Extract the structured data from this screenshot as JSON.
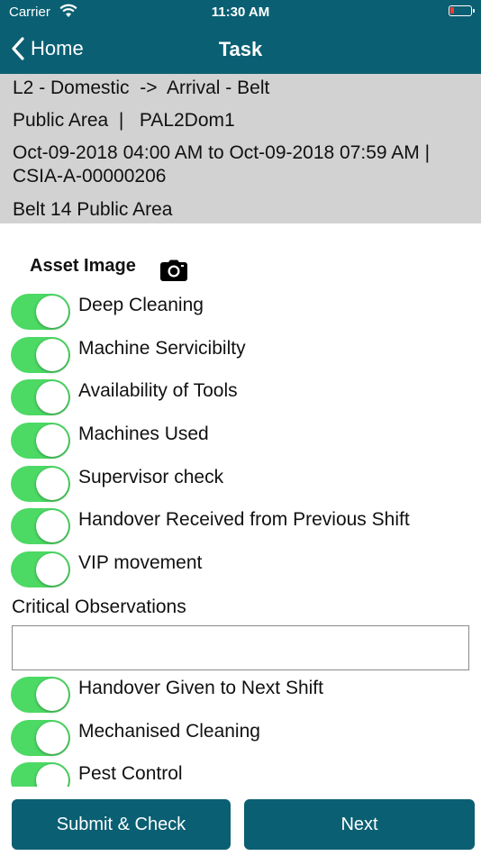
{
  "status_bar": {
    "carrier": "Carrier",
    "time": "11:30 AM",
    "battery_color": "#ff3b30"
  },
  "nav": {
    "back_label": "Home",
    "title": "Task"
  },
  "info": {
    "route": "L2 - Domestic  ->  Arrival - Belt",
    "area": "Public Area  |   PAL2Dom1",
    "schedule_line1": "Oct-09-2018 04:00 AM to Oct-09-2018 07:59 AM |",
    "schedule_line2": "CSIA-A-00000206",
    "location": "Belt 14 Public Area"
  },
  "asset": {
    "label": "Asset Image",
    "icon": "camera-icon"
  },
  "checklist": [
    {
      "label": "Deep Cleaning",
      "on": true
    },
    {
      "label": "Machine Servicibilty",
      "on": true
    },
    {
      "label": "Availability of Tools",
      "on": true
    },
    {
      "label": "Machines Used",
      "on": true
    },
    {
      "label": "Supervisor check",
      "on": true
    },
    {
      "label": "Handover Received from Previous Shift",
      "on": true
    },
    {
      "label": "VIP movement",
      "on": true
    }
  ],
  "critical": {
    "label": "Critical Observations",
    "value": "",
    "placeholder": ""
  },
  "checklist2": [
    {
      "label": "Handover Given to Next Shift",
      "on": true
    },
    {
      "label": "Mechanised Cleaning",
      "on": true
    },
    {
      "label": "Pest Control",
      "on": true
    }
  ],
  "buttons": {
    "submit": "Submit & Check",
    "next": "Next"
  },
  "colors": {
    "accent": "#0b5f73",
    "toggle_on": "#4cd964",
    "info_bg": "#d2d2d2"
  }
}
